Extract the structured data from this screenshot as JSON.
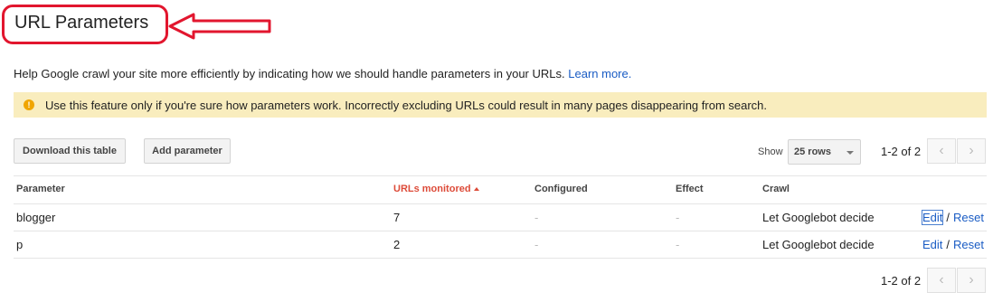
{
  "page": {
    "title": "URL Parameters",
    "help_text": "Help Google crawl your site more efficiently by indicating how we should handle parameters in your URLs.",
    "learn_more": "Learn more.",
    "warning": "Use this feature only if you're sure how parameters work. Incorrectly excluding URLs could result in many pages disappearing from search."
  },
  "toolbar": {
    "download_label": "Download this table",
    "add_label": "Add parameter",
    "show_label": "Show",
    "rows_value": "25 rows",
    "pager_text": "1-2 of 2"
  },
  "table": {
    "headers": {
      "parameter": "Parameter",
      "urls_monitored": "URLs monitored",
      "configured": "Configured",
      "effect": "Effect",
      "crawl": "Crawl"
    },
    "rows": [
      {
        "parameter": "blogger",
        "urls_monitored": "7",
        "configured": "-",
        "effect": "-",
        "crawl": "Let Googlebot decide",
        "edit": "Edit",
        "sep": "/",
        "reset": "Reset"
      },
      {
        "parameter": "p",
        "urls_monitored": "2",
        "configured": "-",
        "effect": "-",
        "crawl": "Let Googlebot decide",
        "edit": "Edit",
        "sep": "/",
        "reset": "Reset"
      }
    ]
  },
  "footer": {
    "pager_text": "1-2 of 2"
  },
  "annotation": {
    "color": "#e2162e"
  },
  "colors": {
    "link": "#1a5cc4",
    "warning_bg": "#f9edbe",
    "sorted_header": "#dd4b39"
  }
}
